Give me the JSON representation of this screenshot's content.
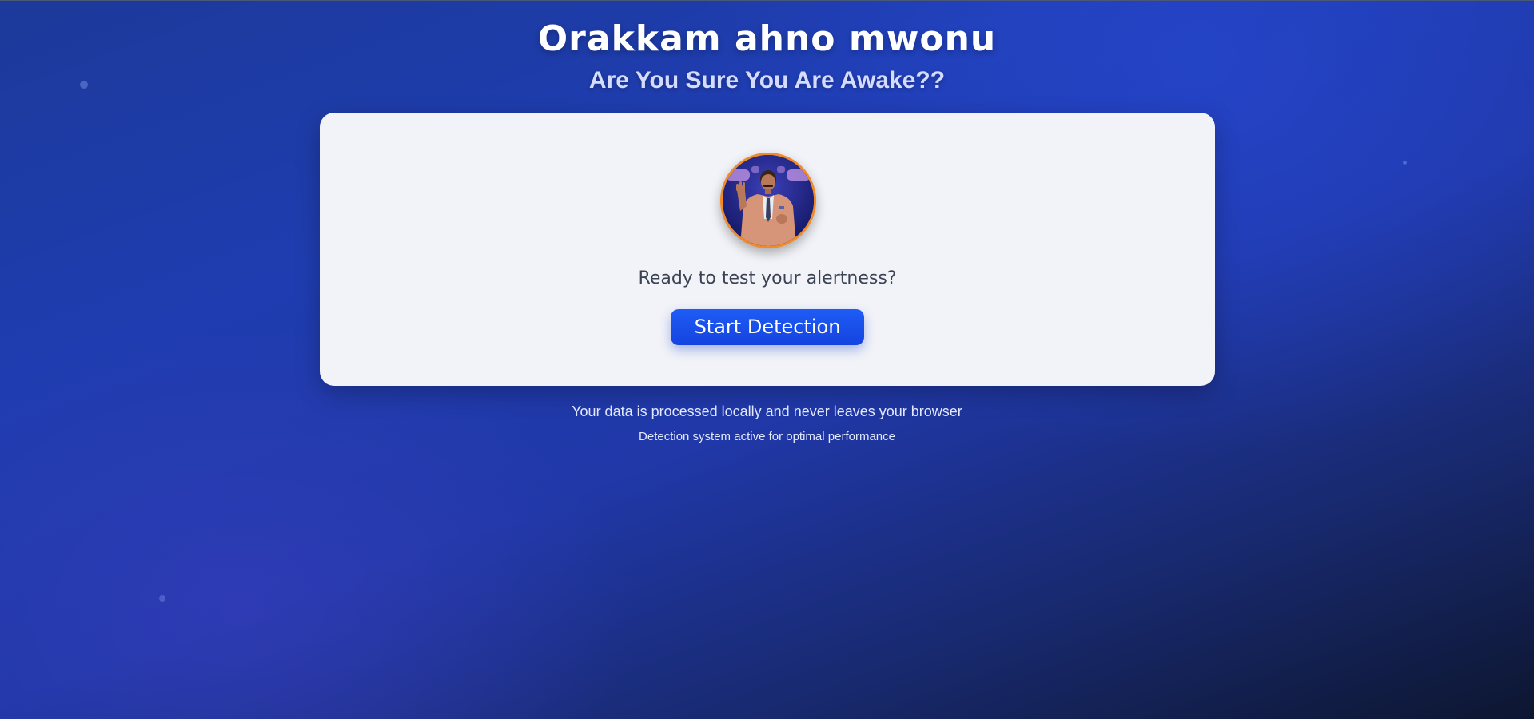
{
  "header": {
    "title": "Orakkam ahno mwonu",
    "subtitle": "Are You Sure You Are Awake??"
  },
  "card": {
    "avatar_icon": "presenter-photo",
    "prompt": "Ready to test your alertness?",
    "start_button_label": "Start Detection"
  },
  "footer": {
    "privacy_note": "Your data is processed locally and never leaves your browser",
    "status_note": "Detection system active for optimal performance"
  },
  "colors": {
    "accent": "#1a4ff0",
    "avatar_border": "#f08a2a",
    "card_background": "#f2f3f8"
  }
}
